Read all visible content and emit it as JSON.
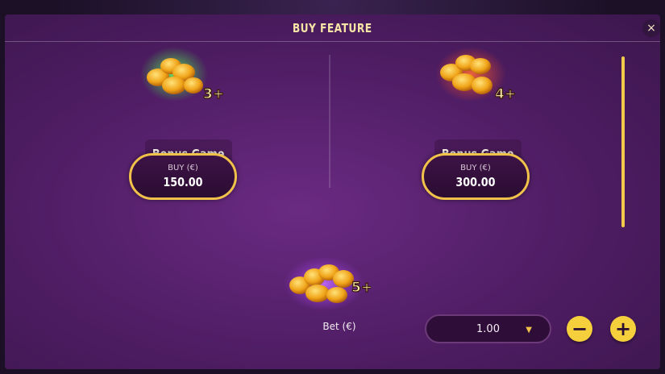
{
  "dialog": {
    "title": "BUY FEATURE",
    "close_glyph": "×"
  },
  "features": [
    {
      "count_badge": "3+",
      "glow_color": "#3adf3a",
      "name": "Bonus Game",
      "buy_label": "BUY (€)",
      "price": "150.00"
    },
    {
      "count_badge": "4+",
      "glow_color": "#e84525",
      "name": "Bonus Game",
      "buy_label": "BUY (€)",
      "price": "300.00"
    },
    {
      "count_badge": "5+",
      "glow_color": "#a43cf0"
    }
  ],
  "bet": {
    "label": "Bet (€)",
    "value": "1.00",
    "dropdown_glyph": "▼",
    "minus_glyph": "−",
    "plus_glyph": "+"
  },
  "colors": {
    "accent": "#f1c24a",
    "panel": "#5a2171",
    "title": "#f6e3a6"
  },
  "icons": {
    "feature_art": "golden-peanuts-icon",
    "close": "close-icon"
  }
}
